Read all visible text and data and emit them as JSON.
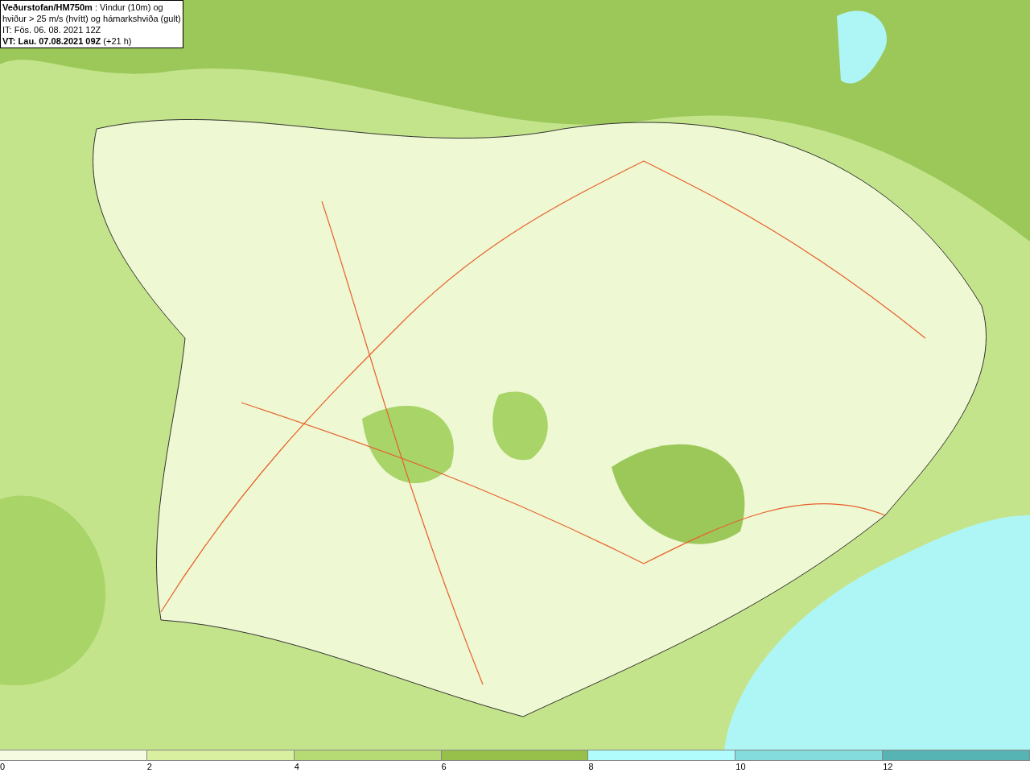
{
  "info_box": {
    "lines": [
      "**Veðurstofan/HM750m** : Vindur (10m) og",
      "hviður > 25 m/s (hvítt) og hámarkshviða (gult)",
      "IT: Fös. 06. 08. 2021 12Z",
      "**VT: Lau. 07.08.2021 09Z** (+21 h)"
    ]
  },
  "legend": [
    {
      "label": "0",
      "color": "#f5fbe0"
    },
    {
      "label": "2",
      "color": "#d8f0a0"
    },
    {
      "label": "4",
      "color": "#b6da74"
    },
    {
      "label": "6",
      "color": "#96c04a"
    },
    {
      "label": "8",
      "color": "#b0fbfb"
    },
    {
      "label": "10",
      "color": "#84dcdc"
    },
    {
      "label": "12",
      "color": "#56b4b4"
    }
  ]
}
